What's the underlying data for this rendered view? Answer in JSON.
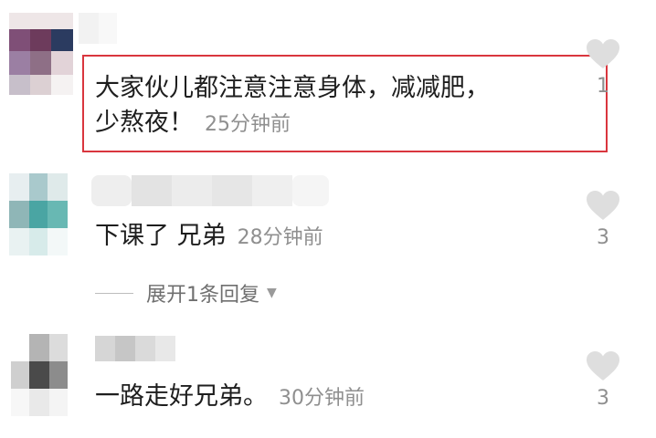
{
  "comments": [
    {
      "text_line1": "大家伙儿都注意注意身体，减减肥，",
      "text_line2": "少熬夜！",
      "time": "25分钟前",
      "likes": "1",
      "highlighted": true
    },
    {
      "text": "下课了 兄弟",
      "time": "28分钟前",
      "likes": "3",
      "replies_label": "展开1条回复"
    },
    {
      "text": "一路走好兄弟。",
      "time": "30分钟前",
      "likes": "3"
    }
  ],
  "colors": {
    "highlight_border": "#d9363e",
    "time_text": "#8f8f8f",
    "heart_icon": "#dedede"
  },
  "icons": {
    "like": "heart-icon",
    "expand": "triangle-down-icon"
  }
}
